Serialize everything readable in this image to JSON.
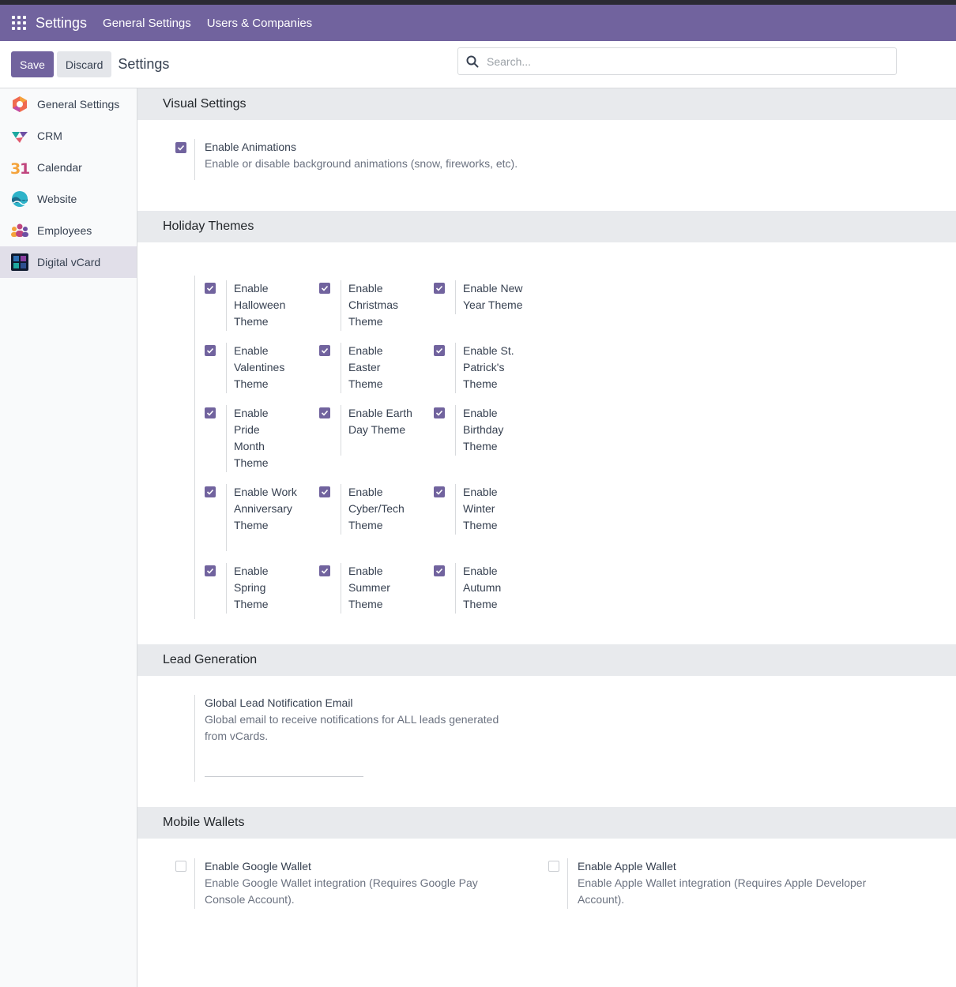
{
  "navbar": {
    "brand": "Settings",
    "menu": [
      "General Settings",
      "Users & Companies"
    ]
  },
  "control": {
    "save": "Save",
    "discard": "Discard",
    "title": "Settings",
    "search_placeholder": "Search..."
  },
  "sidebar": {
    "items": [
      {
        "label": "General Settings",
        "icon": "general-settings-icon",
        "active": false
      },
      {
        "label": "CRM",
        "icon": "crm-icon",
        "active": false
      },
      {
        "label": "Calendar",
        "icon": "calendar-icon",
        "active": false
      },
      {
        "label": "Website",
        "icon": "website-icon",
        "active": false
      },
      {
        "label": "Employees",
        "icon": "employees-icon",
        "active": false
      },
      {
        "label": "Digital vCard",
        "icon": "digital-vcard-icon",
        "active": true
      }
    ]
  },
  "sections": {
    "visual": {
      "title": "Visual Settings",
      "animations": {
        "label": "Enable Animations",
        "desc": "Enable or disable background animations (snow, fireworks, etc).",
        "checked": true
      }
    },
    "holiday": {
      "title": "Holiday Themes",
      "themes": [
        {
          "label": "Enable Halloween Theme",
          "checked": true
        },
        {
          "label": "Enable Christmas Theme",
          "checked": true
        },
        {
          "label": "Enable New Year Theme",
          "checked": true
        },
        {
          "label": "Enable Valentines Theme",
          "checked": true
        },
        {
          "label": "Enable Easter Theme",
          "checked": true
        },
        {
          "label": "Enable St. Patrick's Theme",
          "checked": true
        },
        {
          "label": "Enable Pride Month Theme",
          "checked": true
        },
        {
          "label": "Enable Earth Day Theme",
          "checked": true
        },
        {
          "label": "Enable Birthday Theme",
          "checked": true
        },
        {
          "label": "Enable Work Anniversary Theme",
          "checked": true
        },
        {
          "label": "Enable Cyber/Tech Theme",
          "checked": true
        },
        {
          "label": "Enable Winter Theme",
          "checked": true
        },
        {
          "label": "Enable Spring Theme",
          "checked": true
        },
        {
          "label": "Enable Summer Theme",
          "checked": true
        },
        {
          "label": "Enable Autumn Theme",
          "checked": true
        }
      ]
    },
    "lead": {
      "title": "Lead Generation",
      "email": {
        "label": "Global Lead Notification Email",
        "desc": "Global email to receive notifications for ALL leads generated from vCards.",
        "value": ""
      }
    },
    "wallets": {
      "title": "Mobile Wallets",
      "google": {
        "label": "Enable Google Wallet",
        "desc": "Enable Google Wallet integration (Requires Google Pay Console Account).",
        "checked": false
      },
      "apple": {
        "label": "Enable Apple Wallet",
        "desc": "Enable Apple Wallet integration (Requires Apple Developer Account).",
        "checked": false
      }
    }
  },
  "colors": {
    "brand": "#71639e",
    "section_bg": "#e8eaed",
    "sidebar_active": "#e1dfe9"
  }
}
